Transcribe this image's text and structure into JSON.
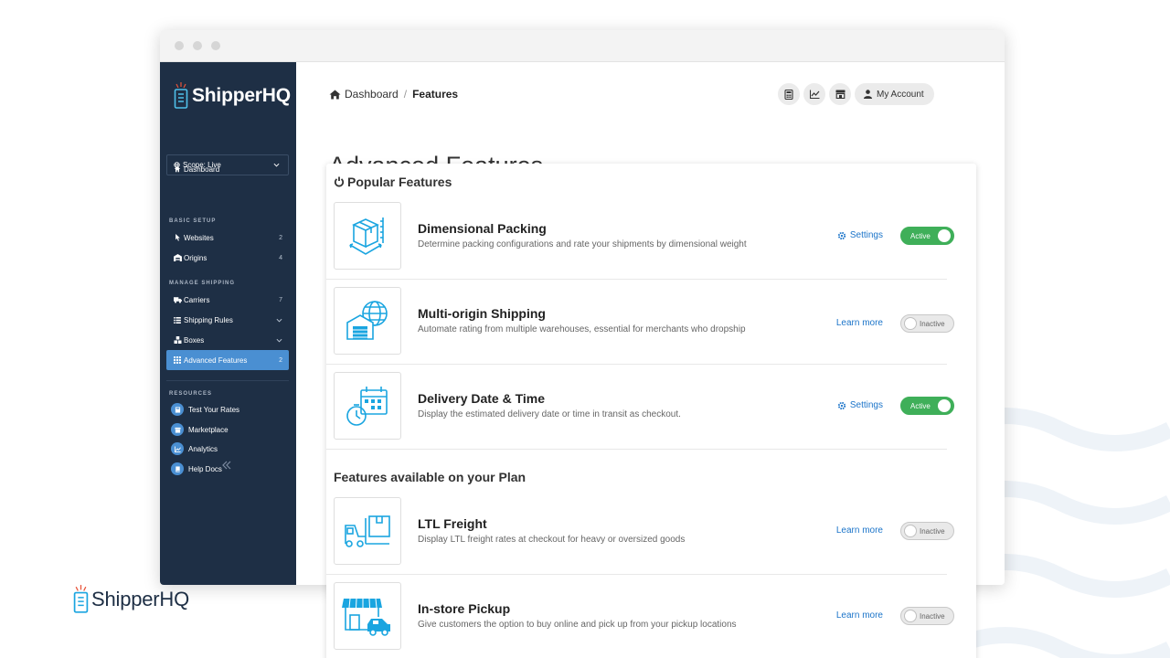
{
  "brand": {
    "name": "ShipperHQ"
  },
  "colors": {
    "sidebar_bg": "#1e2f45",
    "accent_blue": "#4a8fd2",
    "active_green": "#3faf59",
    "link_blue": "#1b74c9"
  },
  "sidebar": {
    "dashboard": {
      "label": "Dashboard",
      "icon": "home-icon"
    },
    "scope": {
      "label": "Scope: Live",
      "icon": "globe-icon"
    },
    "sections": {
      "basic_setup": "BASIC SETUP",
      "manage_shipping": "MANAGE SHIPPING",
      "resources": "RESOURCES"
    },
    "basic_items": [
      {
        "label": "Websites",
        "count": "2",
        "icon": "cursor-icon"
      },
      {
        "label": "Origins",
        "count": "4",
        "icon": "warehouse-icon"
      }
    ],
    "shipping_items": [
      {
        "label": "Carriers",
        "count": "7",
        "icon": "truck-icon"
      },
      {
        "label": "Shipping Rules",
        "icon": "list-icon"
      },
      {
        "label": "Boxes",
        "icon": "boxes-icon"
      },
      {
        "label": "Advanced Features",
        "count": "2",
        "icon": "grid-icon",
        "active": true
      }
    ],
    "resources": [
      {
        "label": "Test Your Rates",
        "icon": "calculator-icon"
      },
      {
        "label": "Marketplace",
        "icon": "store-icon"
      },
      {
        "label": "Analytics",
        "icon": "chart-icon"
      },
      {
        "label": "Help Docs",
        "icon": "book-icon"
      }
    ]
  },
  "header": {
    "breadcrumb": {
      "home": "Dashboard",
      "separator": "/",
      "current": "Features"
    },
    "account_label": "My Account"
  },
  "page": {
    "title": "Advanced Features"
  },
  "popular": {
    "heading": "Popular Features",
    "features": [
      {
        "title": "Dimensional Packing",
        "desc": "Determine packing configurations and rate your shipments by dimensional weight",
        "action": "Settings",
        "status": "Active"
      },
      {
        "title": "Multi-origin Shipping",
        "desc": "Automate rating from multiple warehouses, essential for merchants who dropship",
        "action": "Learn more",
        "status": "Inactive"
      },
      {
        "title": "Delivery Date & Time",
        "desc": "Display the estimated delivery date or time in transit as checkout.",
        "action": "Settings",
        "status": "Active"
      }
    ]
  },
  "plan": {
    "heading": "Features available on your Plan",
    "features": [
      {
        "title": "LTL Freight",
        "desc": "Display LTL freight rates at checkout for heavy or oversized goods",
        "action": "Learn more",
        "status": "Inactive"
      },
      {
        "title": "In-store Pickup",
        "desc": "Give customers the option to buy online and pick up from your pickup locations",
        "action": "Learn more",
        "status": "Inactive"
      }
    ]
  }
}
